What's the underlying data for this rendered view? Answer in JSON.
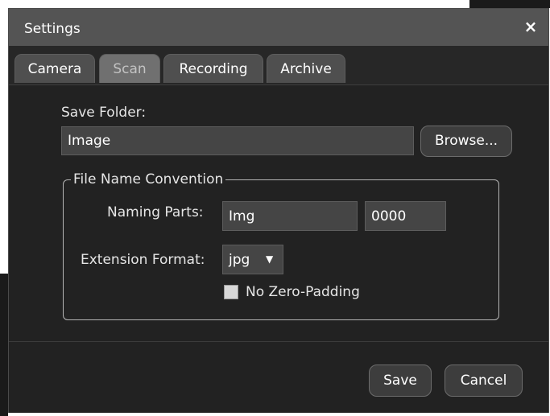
{
  "window": {
    "title": "Settings",
    "close_glyph": "×"
  },
  "tabs": [
    {
      "label": "Camera",
      "active": false
    },
    {
      "label": "Scan",
      "active": true
    },
    {
      "label": "Recording",
      "active": false
    },
    {
      "label": "Archive",
      "active": false
    }
  ],
  "save_folder": {
    "label": "Save Folder:",
    "value": "Image",
    "browse_label": "Browse..."
  },
  "file_name_convention": {
    "legend": "File Name Convention",
    "naming_parts_label": "Naming Parts:",
    "part1_value": "Img",
    "part2_value": "0000",
    "extension_label": "Extension Format:",
    "extension_value": "jpg",
    "dropdown_caret": "▼",
    "no_zero_padding_label": "No Zero-Padding",
    "no_zero_padding_checked": false
  },
  "footer": {
    "save_label": "Save",
    "cancel_label": "Cancel"
  },
  "colors": {
    "titlebar": "#545454",
    "window_bg": "#222222",
    "active_tab": "#707070",
    "inactive_tab": "#4f4f4f"
  }
}
